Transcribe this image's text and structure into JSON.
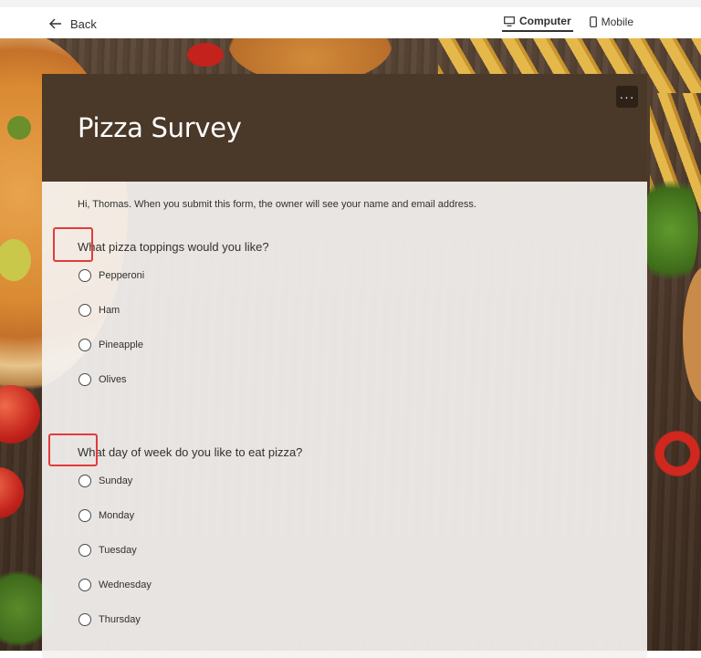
{
  "header": {
    "back_label": "Back",
    "view_options": [
      {
        "label": "Computer",
        "icon": "monitor-icon",
        "active": true
      },
      {
        "label": "Mobile",
        "icon": "phone-icon",
        "active": false
      }
    ]
  },
  "form": {
    "title": "Pizza Survey",
    "more_button_label": "···",
    "notice": "Hi, Thomas. When you submit this form, the owner will see your name and email address.",
    "questions": [
      {
        "text": "What pizza toppings would you like?",
        "options": [
          "Pepperoni",
          "Ham",
          "Pineapple",
          "Olives"
        ]
      },
      {
        "text": "What day of week do you like to eat pizza?",
        "options": [
          "Sunday",
          "Monday",
          "Tuesday",
          "Wednesday",
          "Thursday"
        ]
      }
    ]
  },
  "colors": {
    "header_bg": "#4a3828",
    "highlight": "#e23b3b",
    "card_bg": "#f4f2f0"
  }
}
